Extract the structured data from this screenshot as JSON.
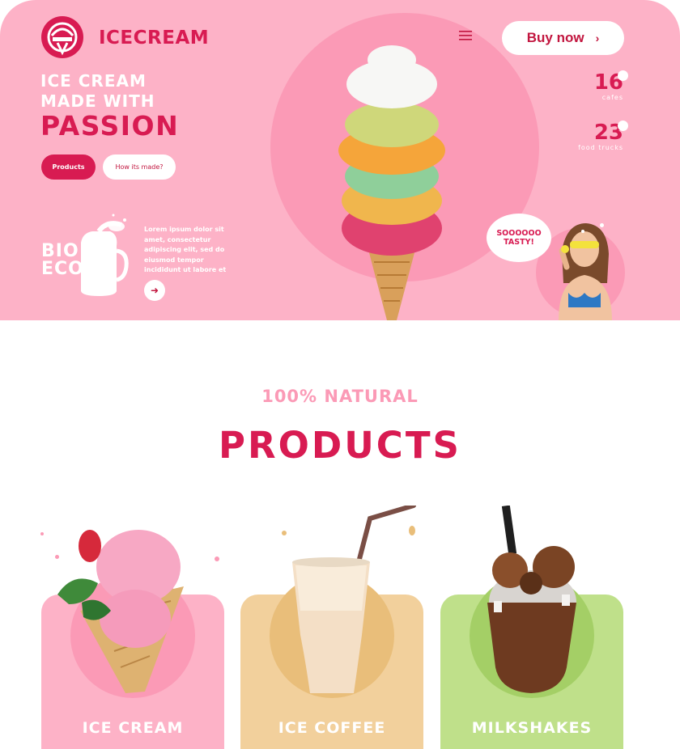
{
  "brand": {
    "name": "ICECREAM"
  },
  "header": {
    "buy_label": "Buy now",
    "buy_chevron": "›"
  },
  "hero": {
    "headline_small": "ICE CREAM MADE WITH",
    "headline_big": "PASSION",
    "products_button": "Products",
    "how_button": "How its made?",
    "bio_line1": "BIO",
    "bio_line2": "ECO",
    "lorem": "Lorem ipsum dolor sit amet, consectetur adipiscing elit, sed do eiusmod tempor incididunt ut labore et",
    "stats": [
      {
        "value": "16",
        "label": "cafes"
      },
      {
        "value": "23",
        "label": "food trucks"
      }
    ],
    "bubble_line1": "SOOOOOO",
    "bubble_line2": "TASTY!"
  },
  "section": {
    "subtitle": "100% NATURAL",
    "title": "PRODUCTS",
    "cards": [
      {
        "label": "ICE CREAM"
      },
      {
        "label": "ICE COFFEE"
      },
      {
        "label": "MILKSHAKES"
      }
    ]
  },
  "colors": {
    "primary": "#d81b52",
    "hero_bg": "#fdb2c7",
    "hero_circle": "#fb9ab6",
    "coffee_card": "#f2d09c",
    "milkshake_card": "#bfe08a"
  },
  "icons": {
    "menu": "menu-icon",
    "arrow": "arrow-right-icon",
    "logo": "ice-cream-logo-icon"
  }
}
